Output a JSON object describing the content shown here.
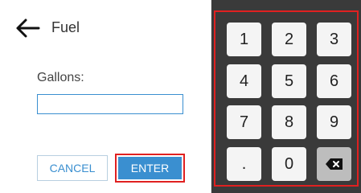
{
  "header": {
    "title": "Fuel",
    "back_icon": "arrow-left-icon"
  },
  "form": {
    "label": "Gallons:",
    "input_value": "",
    "input_placeholder": ""
  },
  "actions": {
    "cancel_label": "CANCEL",
    "enter_label": "ENTER"
  },
  "keypad": {
    "keys": [
      "1",
      "2",
      "3",
      "4",
      "5",
      "6",
      "7",
      "8",
      "9",
      ".",
      "0"
    ],
    "backspace_icon": "backspace-icon"
  },
  "colors": {
    "accent": "#3a8fd0",
    "highlight": "#e02020",
    "keypad_background": "#3a3a3a",
    "key_background": "#f4f4f4",
    "backspace_key_background": "#bdbdbd"
  }
}
